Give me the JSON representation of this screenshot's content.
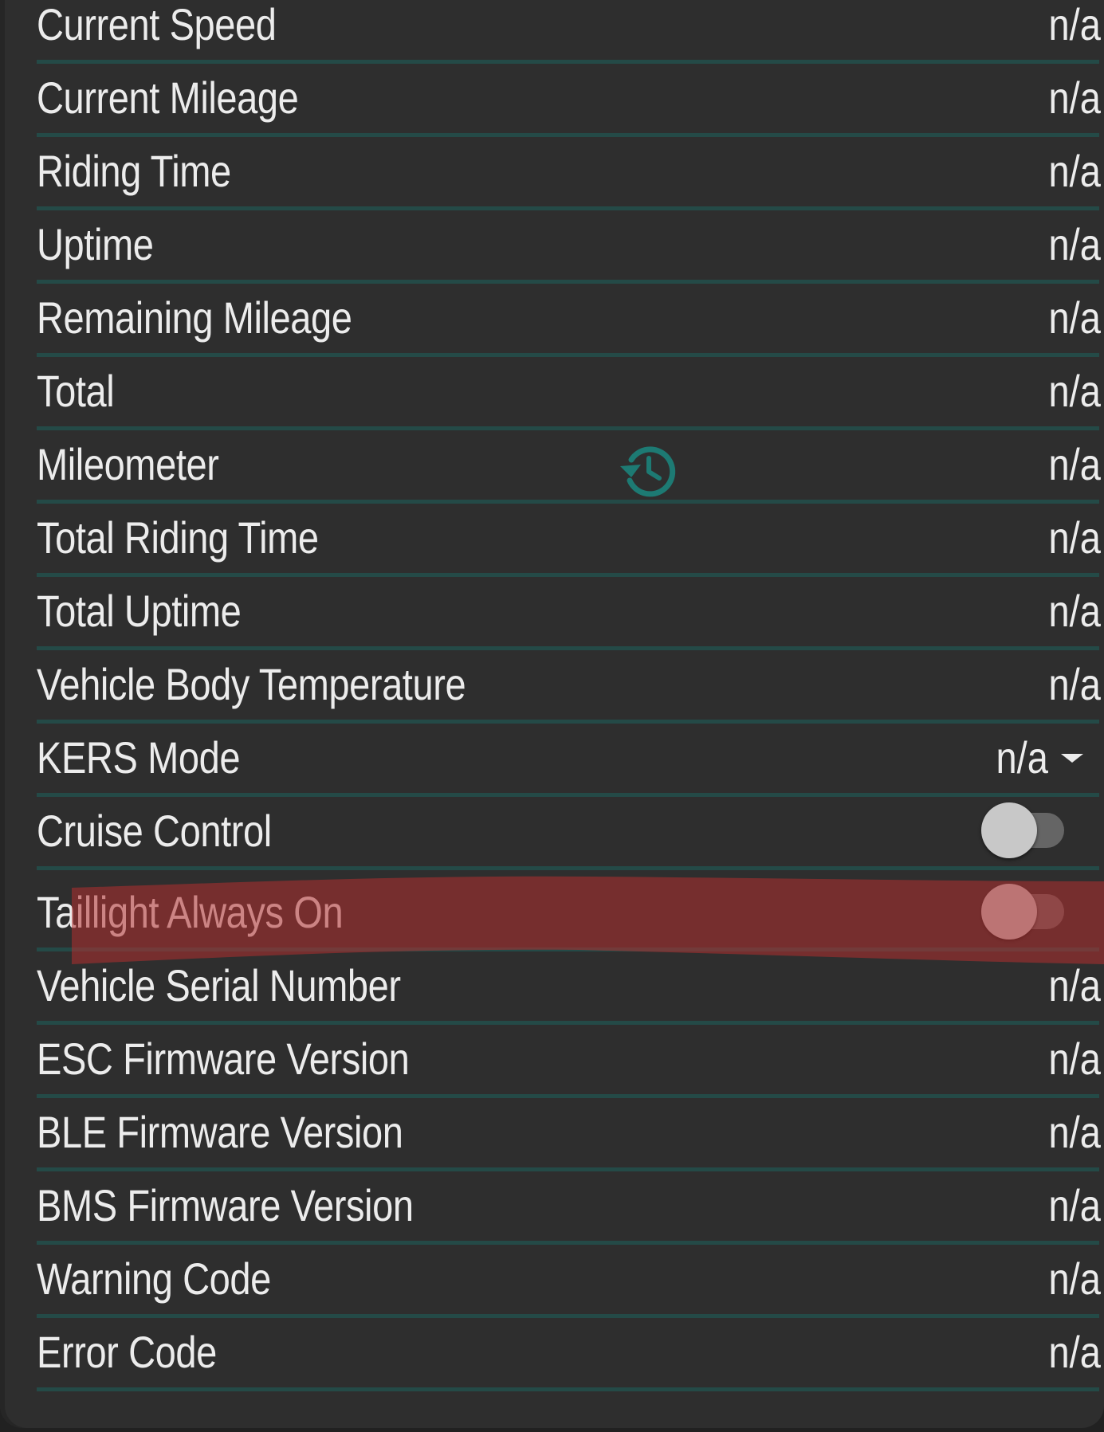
{
  "colors": {
    "background": "#2e2e2e",
    "divider": "#244a47",
    "accent": "#1d7a73",
    "text": "#ececec",
    "highlight_marker": "#b3302f"
  },
  "history_icon": "history-icon",
  "rows": [
    {
      "label": "Current Speed",
      "value": "n/a"
    },
    {
      "label": "Current Mileage",
      "value": "n/a"
    },
    {
      "label": "Riding Time",
      "value": "n/a"
    },
    {
      "label": "Uptime",
      "value": "n/a"
    },
    {
      "label": "Remaining Mileage",
      "value": "n/a"
    },
    {
      "label": "Total",
      "value": "n/a"
    },
    {
      "label": "Mileometer",
      "value": "n/a"
    },
    {
      "label": "Total Riding Time",
      "value": "n/a"
    },
    {
      "label": "Total Uptime",
      "value": "n/a"
    },
    {
      "label": "Vehicle Body Temperature",
      "value": "n/a"
    },
    {
      "label": "KERS Mode",
      "value": "n/a"
    },
    {
      "label": "Cruise Control",
      "value": false
    },
    {
      "label": "Taillight Always On",
      "value": false
    },
    {
      "label": "Vehicle Serial Number",
      "value": "n/a"
    },
    {
      "label": "ESC Firmware Version",
      "value": "n/a"
    },
    {
      "label": "BLE Firmware Version",
      "value": "n/a"
    },
    {
      "label": "BMS Firmware Version",
      "value": "n/a"
    },
    {
      "label": "Warning Code",
      "value": "n/a"
    },
    {
      "label": "Error Code",
      "value": "n/a"
    }
  ]
}
